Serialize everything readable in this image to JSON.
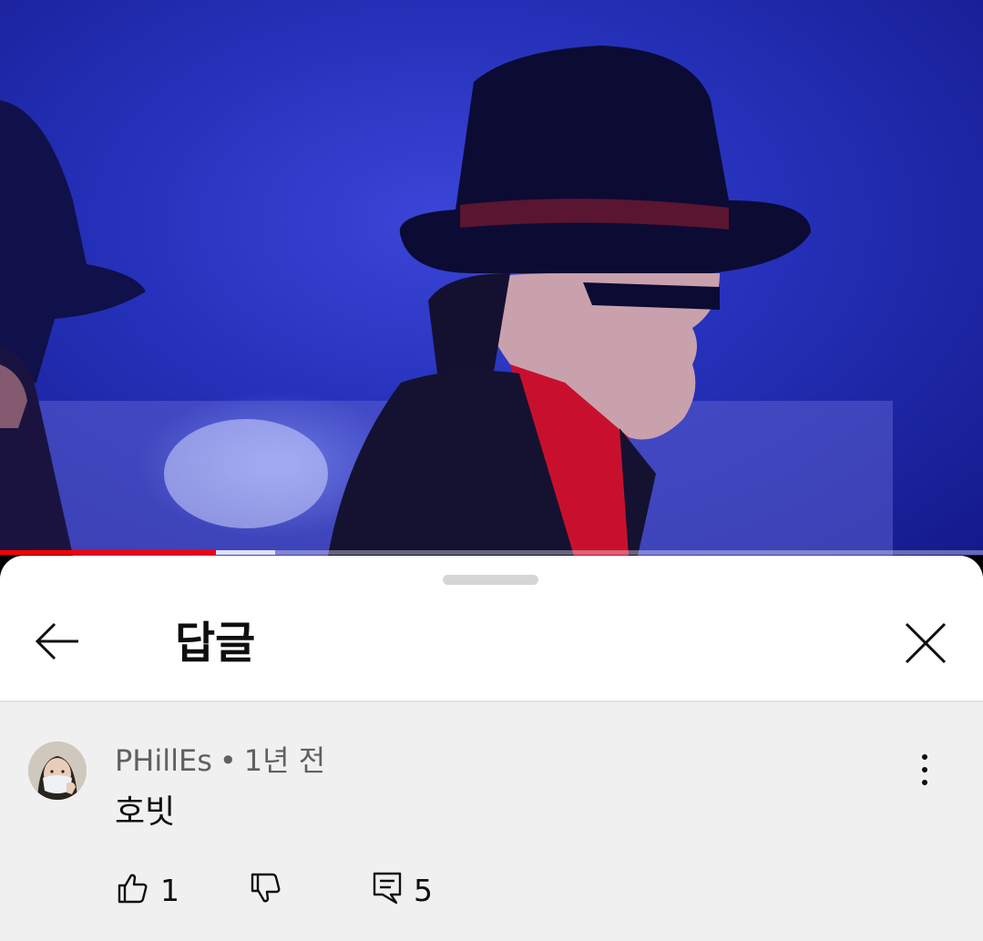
{
  "video": {
    "progress_played": 0.22,
    "progress_buffered": 0.28,
    "colors": {
      "progress_played": "#ff0000"
    }
  },
  "sheet": {
    "title": "답글",
    "back_icon": "arrow-left-icon",
    "close_icon": "close-icon"
  },
  "comment": {
    "author": "PHillEs",
    "separator": "•",
    "time": "1년 전",
    "text": "호빗",
    "more_icon": "more-vert-icon",
    "likes": "1",
    "replies": "5",
    "icons": {
      "like": "thumb-up-icon",
      "dislike": "thumb-down-icon",
      "reply": "comment-icon"
    }
  },
  "colors": {
    "sheet_header_bg": "#ffffff",
    "sheet_body_bg": "#f0f0f0",
    "text_primary": "#0f0f0f",
    "text_secondary": "#606060"
  }
}
